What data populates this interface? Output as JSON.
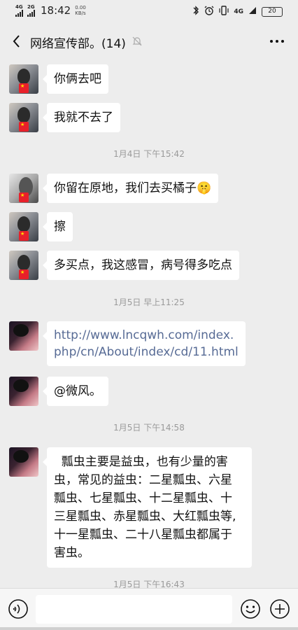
{
  "status_bar": {
    "signal1": "4G",
    "signal2": "2G",
    "time": "18:42",
    "speed_value": "0.00",
    "speed_unit": "KB/s",
    "net_type": "4G",
    "battery": "20"
  },
  "header": {
    "title": "网络宣传部。(14)"
  },
  "messages": [
    {
      "text": "你俩去吧"
    },
    {
      "text": "我就不去了"
    },
    {
      "text": "你留在原地，我们去买橘子🤫"
    },
    {
      "text": "擦"
    },
    {
      "text": "多买点，我这感冒，病号得多吃点"
    },
    {
      "text_line1": "http://www.lncqwh.com/index.",
      "text_line2": "php/cn/About/index/cd/11.html"
    },
    {
      "text": "@微风。"
    },
    {
      "line1": "  瓢虫主要是益虫，也有少量的害",
      "line2": "虫，常见的益虫：二星瓢虫、六星",
      "line3": "瓢虫、七星瓢虫、十二星瓢虫、十",
      "line4": "三星瓢虫、赤星瓢虫、大红瓢虫等,",
      "line5": "十一星瓢虫、二十八星瓢虫都属于",
      "line6": "害虫。"
    }
  ],
  "timestamps": {
    "t1": "1月4日 下午15:42",
    "t2": "1月5日 早上11:25",
    "t3": "1月5日 下午14:58",
    "t4": "1月5日 下午16:43"
  },
  "flag_glyph": "★",
  "colors": {
    "background": "#ededed",
    "bubble": "#ffffff",
    "link": "#576b95",
    "timestamp": "#9a9a9a",
    "flag": "#e8202a"
  }
}
